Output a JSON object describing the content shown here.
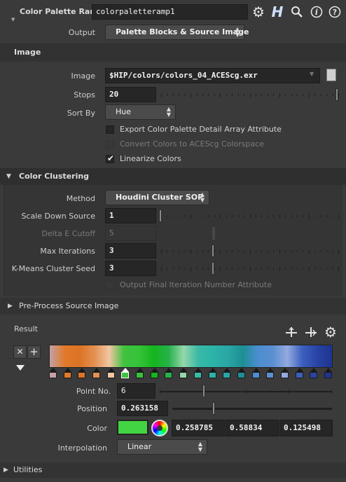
{
  "header": {
    "node_type": "Color Palette Ramp",
    "node_name": "colorpaletteramp1",
    "icons": [
      "gear-icon",
      "houdini-h-icon",
      "search-icon",
      "info-icon",
      "help-icon"
    ]
  },
  "output": {
    "label": "Output",
    "value": "Palette Blocks & Source Image"
  },
  "image_tab": {
    "label": "Image"
  },
  "image_params": {
    "image": {
      "label": "Image",
      "value": "$HIP/colors/colors_04_ACEScg.exr"
    },
    "stops": {
      "label": "Stops",
      "value": "20"
    },
    "sort_by": {
      "label": "Sort By",
      "value": "Hue"
    },
    "export_detail": {
      "label": "Export Color Palette Detail Array Attribute",
      "checked": false
    },
    "convert_acescg": {
      "label": "Convert Colors to ACEScg Colorspace",
      "checked": false,
      "disabled": true
    },
    "linearize": {
      "label": "Linearize Colors",
      "checked": true
    }
  },
  "clustering": {
    "title": "Color Clustering",
    "method": {
      "label": "Method",
      "value": "Houdini Cluster SOP"
    },
    "scale_down": {
      "label": "Scale Down Source",
      "value": "1"
    },
    "delta_e": {
      "label": "Delta E Cutoff",
      "value": "5",
      "disabled": true
    },
    "max_iter": {
      "label": "Max Iterations",
      "value": "3"
    },
    "seed": {
      "label": "K-Means Cluster Seed",
      "value": "3"
    },
    "output_final": {
      "label": "Output Final Iteration Number Attribute",
      "disabled": true
    }
  },
  "preprocess": {
    "title": "Pre-Process Source Image"
  },
  "result": {
    "label": "Result",
    "point_no": {
      "label": "Point No.",
      "value": "6"
    },
    "position": {
      "label": "Position",
      "value": "0.263158"
    },
    "color": {
      "label": "Color",
      "r": "0.258785",
      "g": "0.58834",
      "b": "0.125498",
      "swatch": "#43d443"
    },
    "interpolation": {
      "label": "Interpolation",
      "value": "Linear"
    },
    "ramp_colors": [
      "#c5a0a6",
      "#e07a2a",
      "#dc7326",
      "#e39051",
      "#f2c5a2",
      "#3fc23f",
      "#36c33a",
      "#14b51d",
      "#27b14b",
      "#95d7aa",
      "#3ab9a5",
      "#2bb3a8",
      "#2aa6a4",
      "#1d8f94",
      "#4b8dd0",
      "#5a8fd0",
      "#93a9df",
      "#3c5fc0",
      "#2844a5",
      "#1f3390"
    ],
    "selected_point": 6
  },
  "utilities": {
    "title": "Utilities"
  }
}
